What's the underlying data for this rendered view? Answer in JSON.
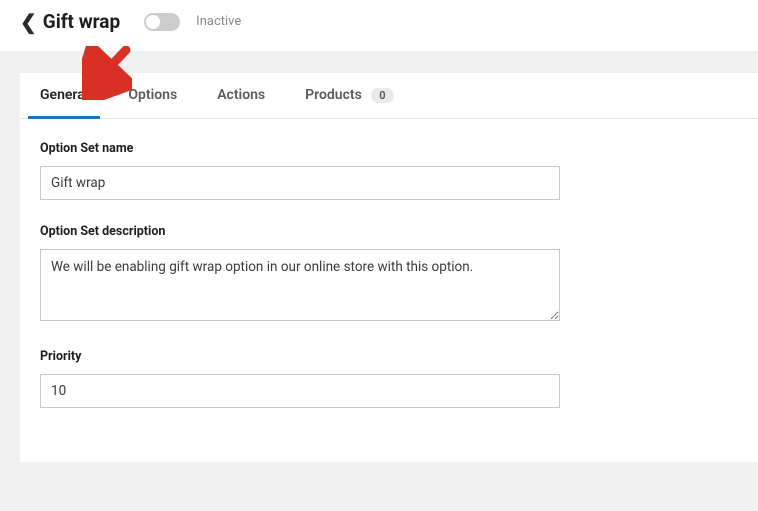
{
  "header": {
    "title": "Gift wrap",
    "toggle_state_label": "Inactive"
  },
  "tabs": [
    {
      "label": "General",
      "active": true
    },
    {
      "label": "Options",
      "active": false
    },
    {
      "label": "Actions",
      "active": false
    },
    {
      "label": "Products",
      "active": false,
      "badge": "0"
    }
  ],
  "form": {
    "name": {
      "label": "Option Set name",
      "value": "Gift wrap"
    },
    "description": {
      "label": "Option Set description",
      "value": "We will be enabling gift wrap option in our online store with this option."
    },
    "priority": {
      "label": "Priority",
      "value": "10"
    }
  },
  "annotation": {
    "arrow_color": "#d93025"
  }
}
